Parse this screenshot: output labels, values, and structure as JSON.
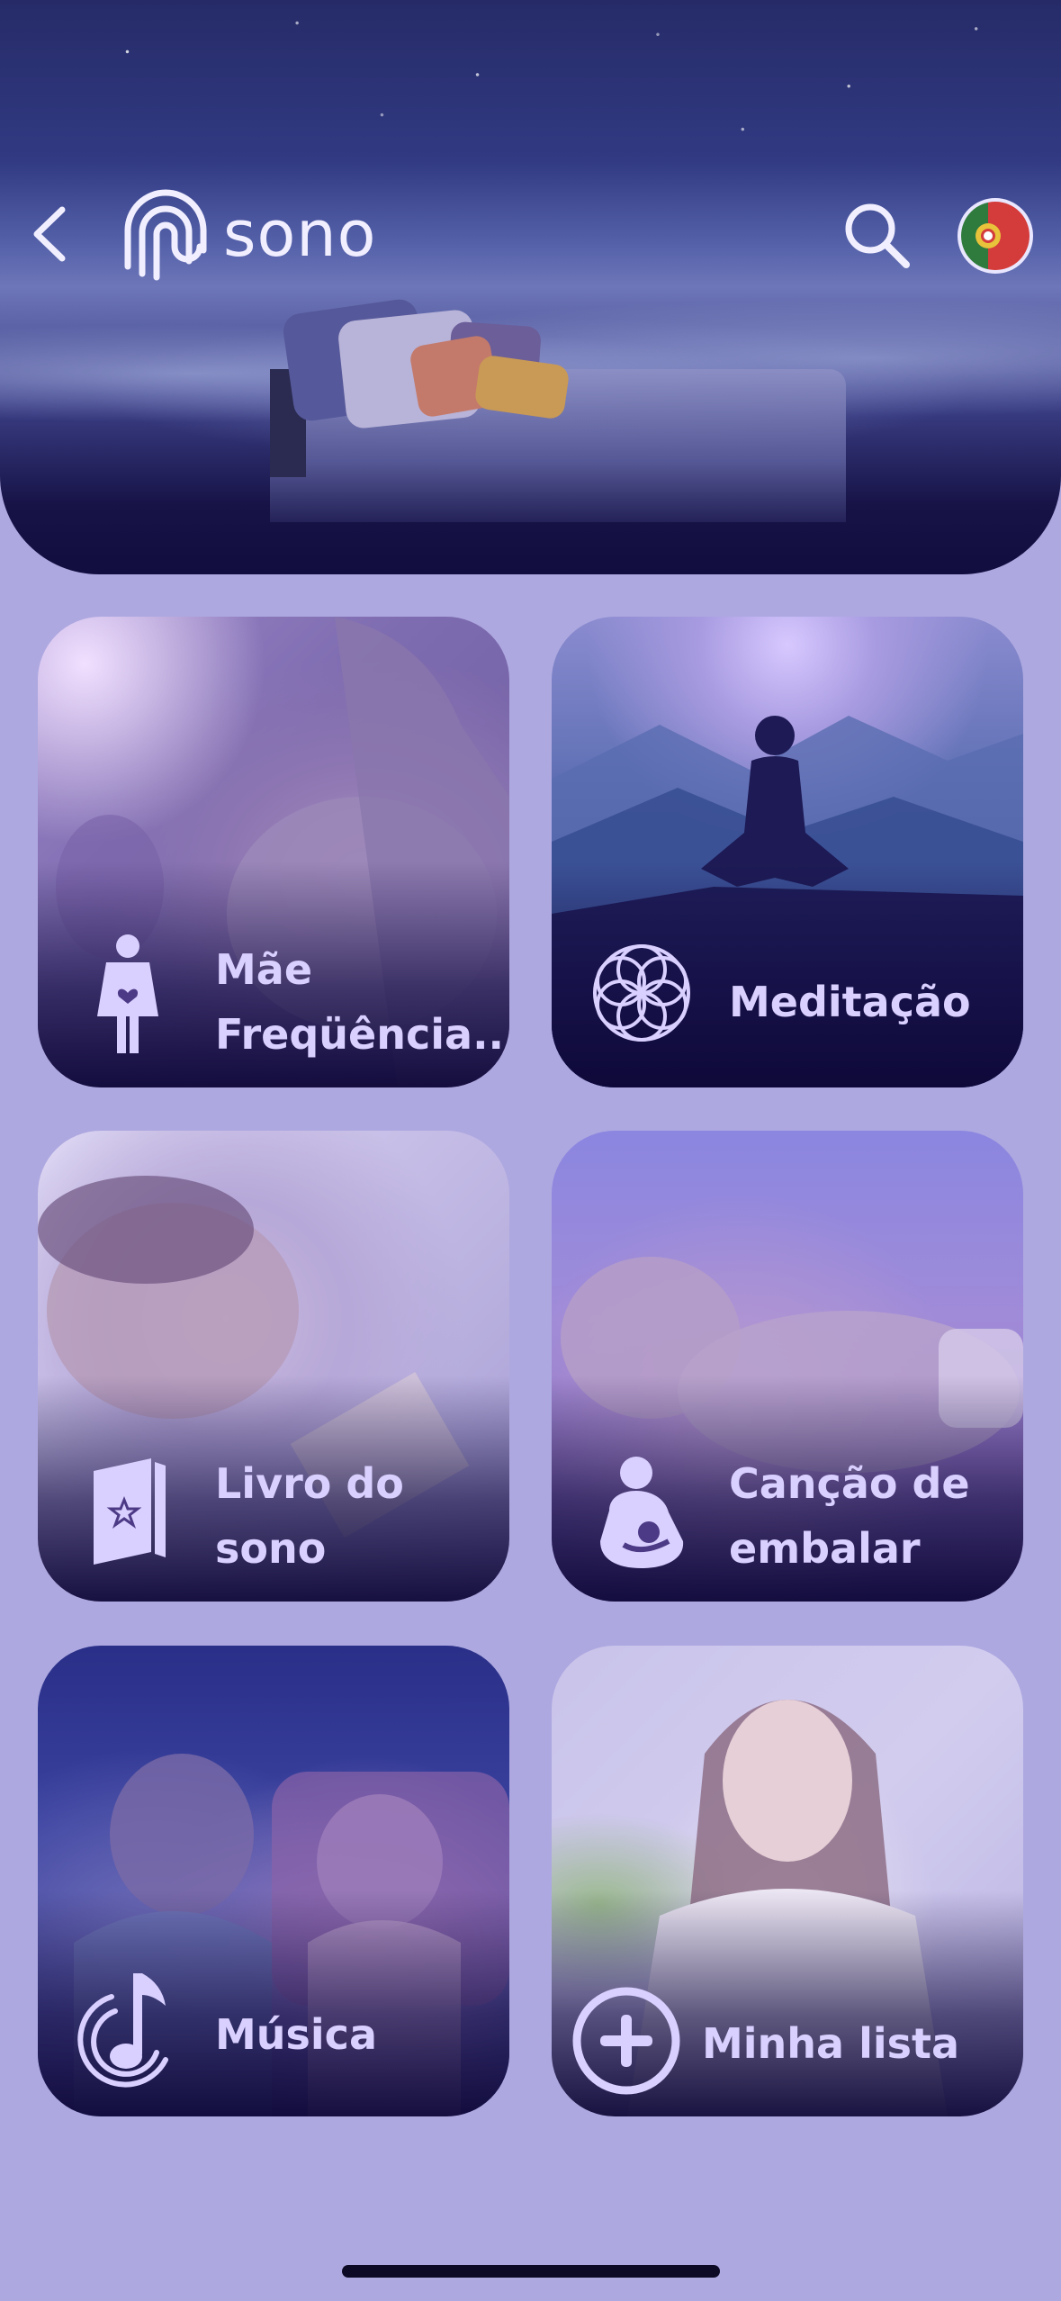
{
  "header": {
    "logo_text": "sono",
    "back_icon": "chevron-left-icon",
    "search_icon": "search-icon",
    "language_flag": "portugal-flag-icon"
  },
  "cards": [
    {
      "label_line1": "Mãe",
      "label_line2": "Freqüência...",
      "icon": "pregnant-woman-icon"
    },
    {
      "label_line1": "Meditação",
      "icon": "mandala-flower-icon"
    },
    {
      "label_line1": "Livro do",
      "label_line2": "sono",
      "icon": "star-book-icon"
    },
    {
      "label_line1": "Canção de",
      "label_line2": "embalar",
      "icon": "breastfeeding-icon"
    },
    {
      "label_line1": "Música",
      "icon": "music-note-icon"
    },
    {
      "label_line1": "Minha lista",
      "icon": "plus-circle-icon"
    }
  ],
  "colors": {
    "background": "#ada8e0",
    "label": "#d9d0ff",
    "header_dark": "#110d3e"
  }
}
